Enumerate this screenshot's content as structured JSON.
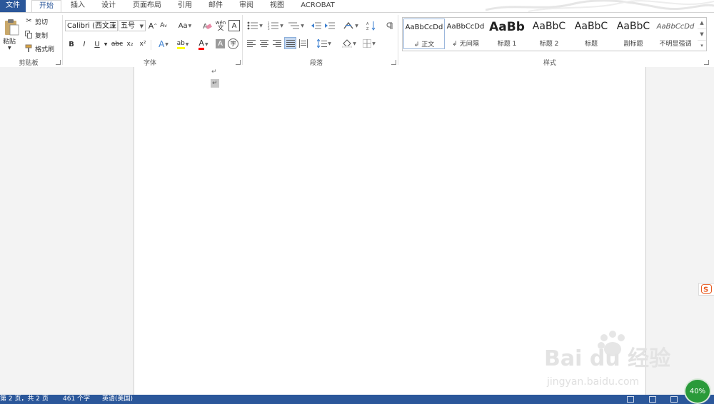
{
  "tabs": [
    "文件",
    "开始",
    "插入",
    "设计",
    "页面布局",
    "引用",
    "邮件",
    "审阅",
    "视图",
    "ACROBAT"
  ],
  "clipboard": {
    "paste_label": "粘贴",
    "cut_label": "剪切",
    "copy_label": "复制",
    "format_painter_label": "格式刷",
    "group_label": "剪贴板"
  },
  "font": {
    "font_name": "Calibri (西文正",
    "font_size": "五号",
    "grow_label": "A",
    "shrink_label": "A",
    "case_label": "Aa",
    "phonetic_label": "wén",
    "phonetic_sub": "文",
    "charborder_label": "A",
    "bold": "B",
    "italic": "I",
    "underline": "U",
    "strike": "abc",
    "subscript": "x₂",
    "superscript": "x²",
    "effects_label": "A",
    "highlight_label": "ab",
    "fontcolor_label": "A",
    "shading_label": "A",
    "enclose_label": "字",
    "group_label": "字体"
  },
  "paragraph": {
    "group_label": "段落"
  },
  "styles": {
    "items": [
      {
        "sample": "AaBbCcDd",
        "name": "↲ 正文"
      },
      {
        "sample": "AaBbCcDd",
        "name": "↲ 无间隔"
      },
      {
        "sample": "AaBb",
        "name": "标题 1"
      },
      {
        "sample": "AaBbC",
        "name": "标题 2"
      },
      {
        "sample": "AaBbC",
        "name": "标题"
      },
      {
        "sample": "AaBbC",
        "name": "副标题"
      },
      {
        "sample": "AaBbCcDd",
        "name": "不明显强调"
      }
    ],
    "group_label": "样式"
  },
  "document": {
    "paragraph_mark_1": "↵",
    "paragraph_mark_2": "↵"
  },
  "status": {
    "page": "第 2 页，共 2 页",
    "words": "461 个字",
    "language": "英语(美国)"
  },
  "zoom_badge": "40%",
  "watermark": {
    "brand": "Bai du 经验",
    "url": "jingyan.baidu.com"
  },
  "colors": {
    "accent": "#2b579a",
    "highlight": "#ffff00",
    "font_color": "#ff0000",
    "badge": "#2a9a3a"
  }
}
